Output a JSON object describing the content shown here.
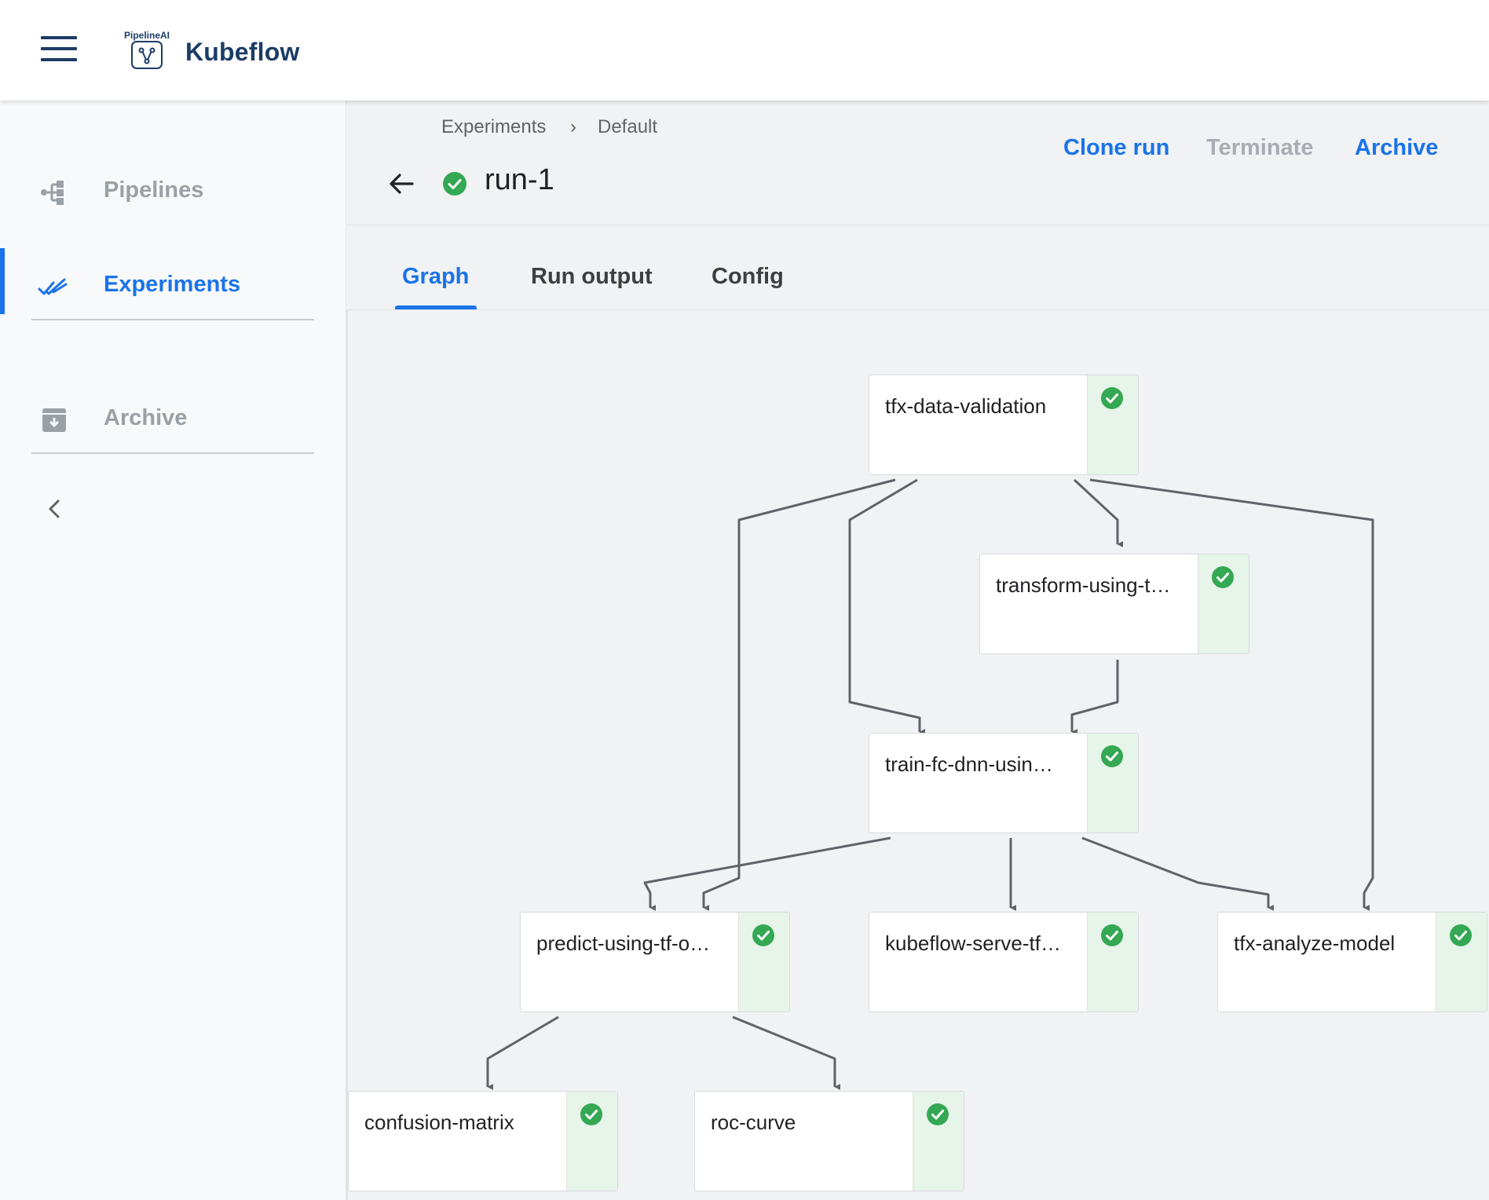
{
  "app": {
    "logo_text": "PipelineAI",
    "brand": "Kubeflow"
  },
  "sidebar": {
    "items": [
      {
        "label": "Pipelines",
        "icon": "pipelines-icon",
        "active": false
      },
      {
        "label": "Experiments",
        "icon": "experiments-icon",
        "active": true
      },
      {
        "label": "Archive",
        "icon": "archive-icon",
        "active": false
      }
    ]
  },
  "breadcrumb": {
    "items": [
      "Experiments",
      "Default"
    ],
    "separator": "›"
  },
  "run": {
    "title": "run-1",
    "status": "succeeded"
  },
  "actions": {
    "clone": "Clone run",
    "terminate": "Terminate",
    "archive": "Archive"
  },
  "tabs": [
    {
      "label": "Graph",
      "active": true
    },
    {
      "label": "Run output",
      "active": false
    },
    {
      "label": "Config",
      "active": false
    }
  ],
  "graph": {
    "nodes": [
      {
        "id": "tfx-data-validation",
        "label": "tfx-data-validation",
        "status": "succeeded"
      },
      {
        "id": "transform",
        "label": "transform-using-t…",
        "status": "succeeded"
      },
      {
        "id": "train",
        "label": "train-fc-dnn-usin…",
        "status": "succeeded"
      },
      {
        "id": "predict",
        "label": "predict-using-tf-o…",
        "status": "succeeded"
      },
      {
        "id": "serve",
        "label": "kubeflow-serve-tf…",
        "status": "succeeded"
      },
      {
        "id": "analyze",
        "label": "tfx-analyze-model",
        "status": "succeeded"
      },
      {
        "id": "confusion",
        "label": "confusion-matrix",
        "status": "succeeded"
      },
      {
        "id": "roc",
        "label": "roc-curve",
        "status": "succeeded"
      }
    ],
    "edges": [
      [
        "tfx-data-validation",
        "transform"
      ],
      [
        "tfx-data-validation",
        "train"
      ],
      [
        "tfx-data-validation",
        "predict"
      ],
      [
        "tfx-data-validation",
        "analyze"
      ],
      [
        "transform",
        "train"
      ],
      [
        "train",
        "predict"
      ],
      [
        "train",
        "serve"
      ],
      [
        "train",
        "analyze"
      ],
      [
        "predict",
        "confusion"
      ],
      [
        "predict",
        "roc"
      ]
    ]
  },
  "colors": {
    "accent": "#1a73e8",
    "success": "#34a853",
    "brand": "#1b3c66",
    "edge": "#5f6368"
  }
}
